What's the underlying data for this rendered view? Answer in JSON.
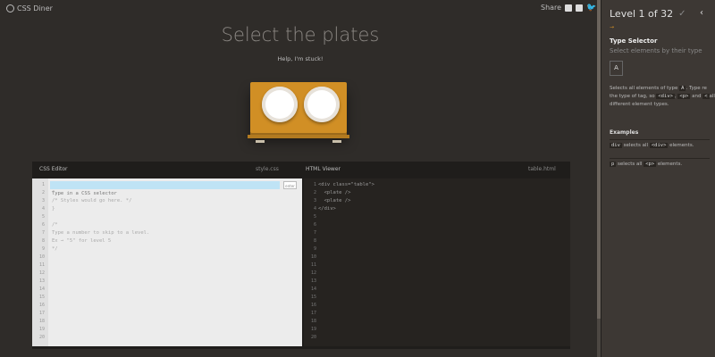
{
  "app": {
    "name": "CSS Diner"
  },
  "share": {
    "label": "Share",
    "icons": [
      "mail-icon",
      "facebook-icon",
      "twitter-icon"
    ]
  },
  "main": {
    "instruction": "Select the plates",
    "help_link": "Help, I'm stuck!"
  },
  "table_scene": {
    "plate_count": 2
  },
  "css_editor": {
    "title": "CSS Editor",
    "file": "style.css",
    "placeholder": "Type in a CSS selector",
    "enter_label": "enter",
    "code_lines": [
      "{",
      "/* Styles would go here. */",
      "}",
      "",
      "/*",
      "Type a number to skip to a level.",
      "Ex → \"5\" for level 5",
      "*/"
    ],
    "line_numbers": [
      "1",
      "2",
      "3",
      "4",
      "5",
      "6",
      "7",
      "8",
      "9",
      "10",
      "11",
      "12",
      "13",
      "14",
      "15",
      "16",
      "17",
      "18",
      "19",
      "20"
    ]
  },
  "html_viewer": {
    "title": "HTML Viewer",
    "file": "table.html",
    "code_lines": [
      "<div class=\"table\">",
      "  <plate />",
      "  <plate />",
      "</div>"
    ],
    "line_numbers": [
      "1",
      "2",
      "3",
      "4",
      "5",
      "6",
      "7",
      "8",
      "9",
      "10",
      "11",
      "12",
      "13",
      "14",
      "15",
      "16",
      "17",
      "18",
      "19",
      "20"
    ]
  },
  "sidebar": {
    "level_label": "Level 1 of 32",
    "selector_name": "Type Selector",
    "selector_title": "Select elements by their type",
    "syntax": "A",
    "description_parts": [
      "Selects all elements of type ",
      "A",
      ". Type re",
      "the type of tag, so ",
      "<div>",
      ", ",
      "<p>",
      " and ",
      "<",
      "all different element types."
    ],
    "examples_title": "Examples",
    "examples": [
      {
        "tag": "div",
        "text_before": " selects all ",
        "tag2": "<div>",
        "text_after": " elements."
      },
      {
        "tag": "p",
        "text_before": " selects all ",
        "tag2": "<p>",
        "text_after": " elements."
      }
    ]
  },
  "colors": {
    "accent": "#d18f25",
    "background": "#2f2c29",
    "sidebar": "#3d3834"
  }
}
